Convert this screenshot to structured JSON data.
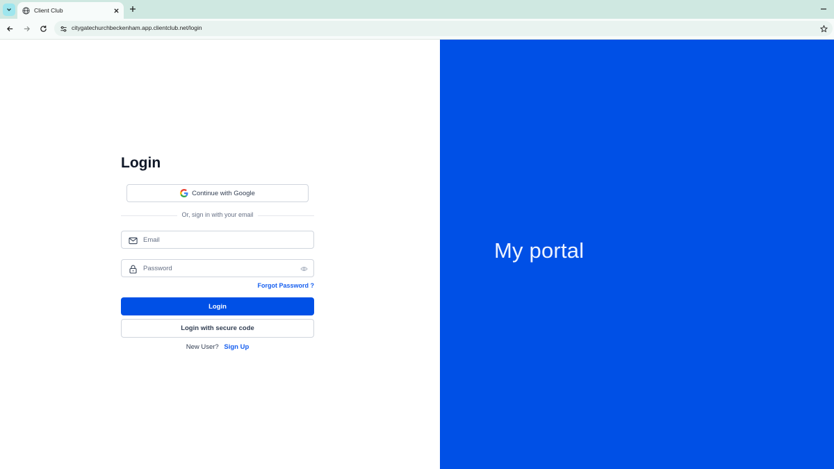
{
  "browser": {
    "tab_title": "Client Club",
    "url": "citygatechurchbeckenham.app.clientclub.net/login"
  },
  "login": {
    "title": "Login",
    "google_label": "Continue with Google",
    "divider_text": "Or, sign in with your email",
    "email_placeholder": "Email",
    "password_placeholder": "Password",
    "forgot_label": "Forgot Password ?",
    "login_label": "Login",
    "secure_code_label": "Login with secure code",
    "new_user_text": "New User?",
    "signup_label": "Sign Up"
  },
  "hero": {
    "title": "My portal"
  },
  "colors": {
    "brand_blue": "#0050e6",
    "link_blue": "#155eef",
    "tabstrip": "#cfe8e1"
  }
}
